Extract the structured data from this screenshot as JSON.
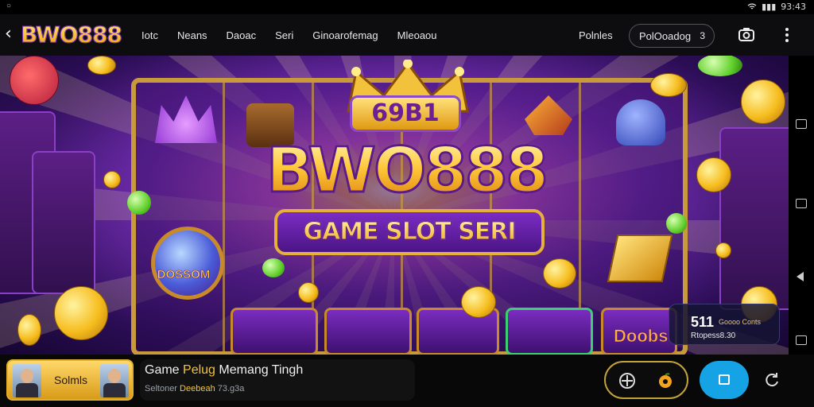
{
  "status_bar": {
    "left_indicator": "○",
    "time": "93:43",
    "battery_label": "▮▮▮"
  },
  "navbar": {
    "brand": "BWO888",
    "links": [
      "Iotc",
      "Neans",
      "Daoac",
      "Seri",
      "Ginoarofemag",
      "Mleoaou"
    ],
    "right_label": "Polnles",
    "pill": {
      "label": "PolOoadog",
      "badge": "3"
    }
  },
  "hero": {
    "crown_badge": "69B1",
    "title": "BWO888",
    "subtitle": "GAME SLOT SERI",
    "orb_label": "DOSSOM",
    "tile_label": "Doobs",
    "jackpot": {
      "value": "511",
      "value_sub": "Goooo Conts",
      "line2": "Rtopess8.30"
    }
  },
  "bottom_bar": {
    "player_label": "Solmls",
    "promo_title_prefix": "Game ",
    "promo_title_highlight": "Pelug",
    "promo_title_suffix": " Memang Tingh",
    "promo_sub_prefix": "Seltoner ",
    "promo_sub_highlight": "Deebeah",
    "promo_sub_suffix": " 73.g3a"
  },
  "colors": {
    "accent_gold": "#f4c33b",
    "brand_purple": "#5b1a8c",
    "action_blue": "#16a3e5"
  },
  "icons": [
    "back-icon",
    "camera-icon",
    "menu-icon",
    "square-icon",
    "back-triangle-icon",
    "target-icon",
    "fruit-icon",
    "rotate-icon"
  ]
}
